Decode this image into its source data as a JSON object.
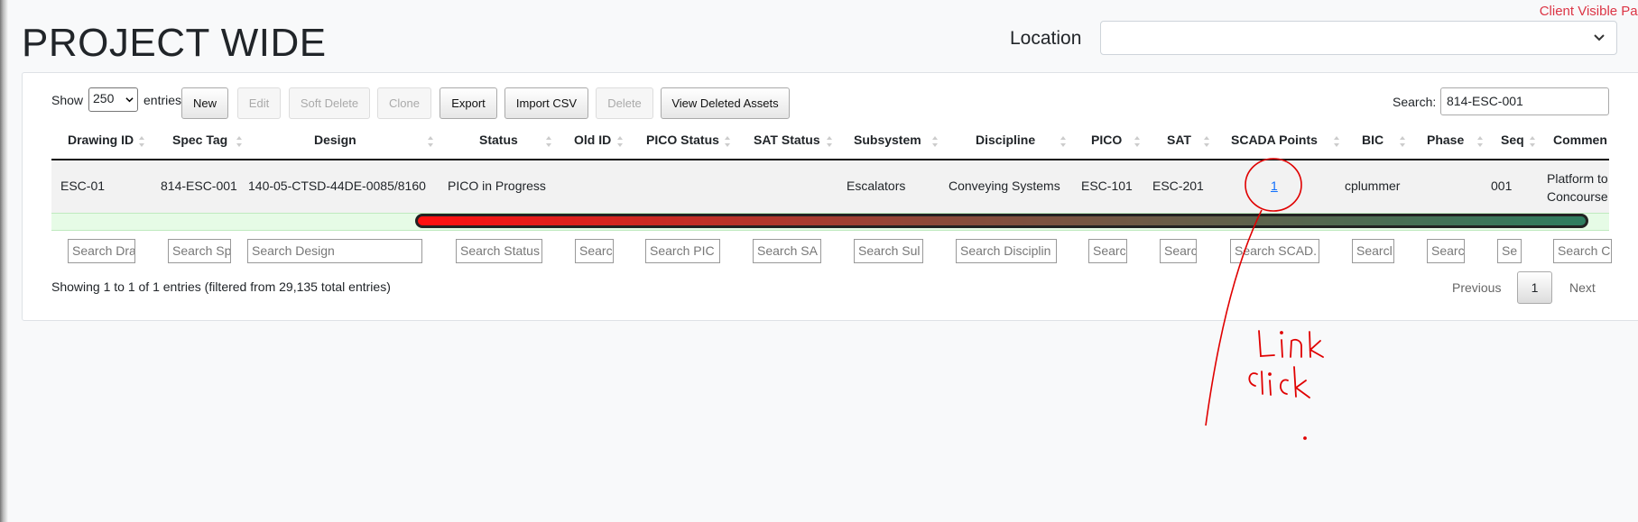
{
  "top_note": "Client Visible Pag",
  "page_title": "PROJECT WIDE",
  "location": {
    "label": "Location",
    "value": ""
  },
  "length": {
    "show": "Show",
    "value": "250",
    "entries": "entries"
  },
  "buttons": [
    "New",
    "Edit",
    "Soft Delete",
    "Clone",
    "Export",
    "Import CSV",
    "Delete",
    "View Deleted Assets"
  ],
  "search": {
    "label": "Search:",
    "value": "814-ESC-001"
  },
  "columns": [
    "Drawing ID",
    "Spec Tag",
    "Design",
    "Status",
    "Old ID",
    "PICO Status",
    "SAT Status",
    "Subsystem",
    "Discipline",
    "PICO",
    "SAT",
    "SCADA Points",
    "BIC",
    "Phase",
    "Seq",
    "Commen"
  ],
  "row": {
    "drawing_id": "ESC-01",
    "spec_tag": "814-ESC-001",
    "design": "140-05-CTSD-44DE-0085/8160",
    "status": "PICO in Progress",
    "subsystem": "Escalators",
    "discipline": "Conveying Systems",
    "pico": "ESC-101",
    "sat": "ESC-201",
    "scada_points": "1",
    "bic": "cplummer",
    "seq": "001",
    "comment_line1": "Platform to",
    "comment_line2": "Concourse"
  },
  "filters": [
    "Search Dra",
    "Search Sp",
    "Search Design",
    "Search Status",
    "Searc",
    "Search PIC",
    "Search SA",
    "Search Sul",
    "Search Disciplin",
    "Searc",
    "Searc",
    "Search SCAD.",
    "Searcl",
    "Searc",
    "Se",
    "Search C"
  ],
  "info": "Showing 1 to 1 of 1 entries (filtered from 29,135 total entries)",
  "pagination": {
    "previous": "Previous",
    "current": "1",
    "next": "Next"
  },
  "annotation": {
    "line1": "Link",
    "line2": "click",
    "color": "#e00000"
  },
  "colors": {
    "accent": "#0d6efd",
    "scrollbar_start": "#ff1010",
    "scrollbar_end": "#2e7d5f"
  }
}
